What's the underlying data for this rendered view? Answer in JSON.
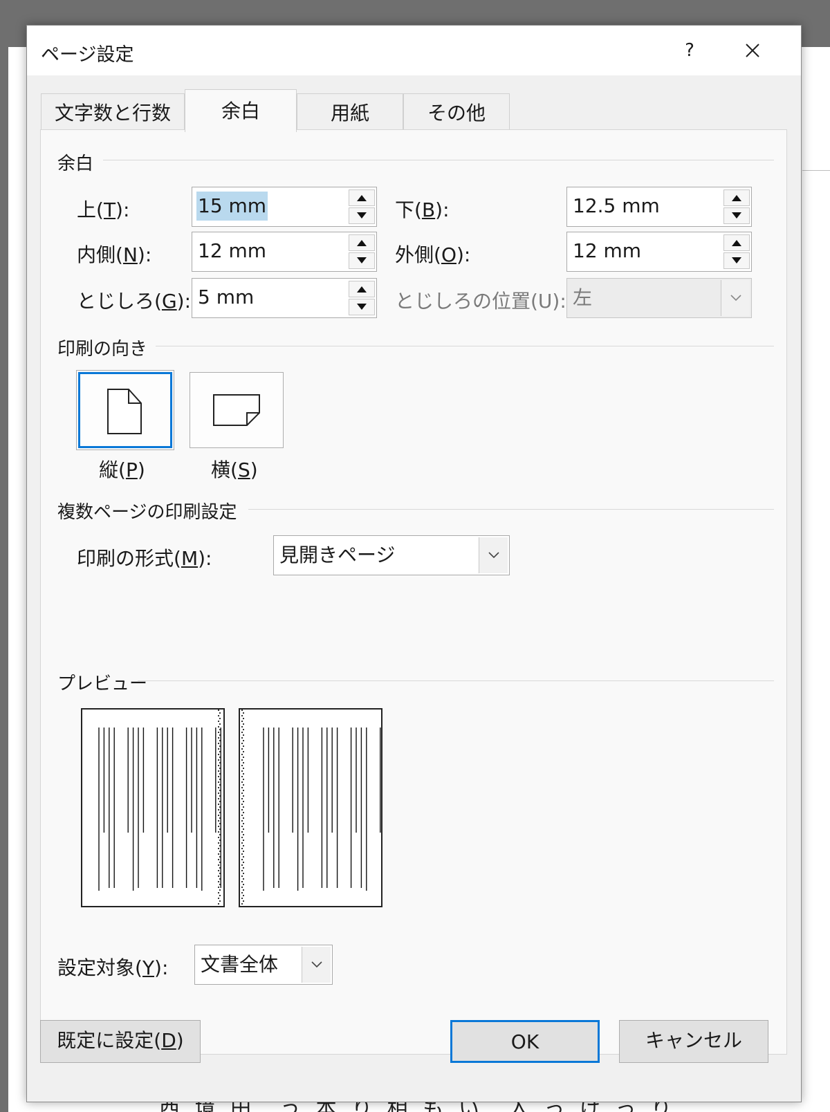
{
  "dialog": {
    "title": "ページ設定",
    "help_label": "?",
    "tabs": [
      {
        "label": "文字数と行数"
      },
      {
        "label": "余白"
      },
      {
        "label": "用紙"
      },
      {
        "label": "その他"
      }
    ],
    "active_tab": "余白"
  },
  "margins": {
    "group_label": "余白",
    "top": {
      "label": "上(",
      "key": "T",
      "suffix": "):",
      "value": "15 mm"
    },
    "bottom": {
      "label": "下(",
      "key": "B",
      "suffix": "):",
      "value": "12.5 mm"
    },
    "inside": {
      "label": "内側(",
      "key": "N",
      "suffix": "):",
      "value": "12 mm"
    },
    "outside": {
      "label": "外側(",
      "key": "O",
      "suffix": "):",
      "value": "12 mm"
    },
    "gutter": {
      "label": "とじしろ(",
      "key": "G",
      "suffix": "):",
      "value": "5 mm"
    },
    "gutter_position": {
      "label": "とじしろの位置(U):",
      "value": "左"
    }
  },
  "orientation": {
    "group_label": "印刷の向き",
    "portrait": {
      "label": "縦(",
      "key": "P",
      "suffix": ")"
    },
    "landscape": {
      "label": "横(",
      "key": "S",
      "suffix": ")"
    },
    "selected": "portrait"
  },
  "multi_page": {
    "group_label": "複数ページの印刷設定",
    "format": {
      "label": "印刷の形式(",
      "key": "M",
      "suffix": "):",
      "value": "見開きページ"
    }
  },
  "preview": {
    "group_label": "プレビュー"
  },
  "apply_to": {
    "label": "設定対象(",
    "key": "Y",
    "suffix": "):",
    "value": "文書全体"
  },
  "buttons": {
    "set_default": {
      "label": "既定に設定(",
      "key": "D",
      "suffix": ")"
    },
    "ok": "OK",
    "cancel": "キャンセル"
  },
  "background": {
    "doc_text": "西 境 田　う 本 り 相 も い　入 っ け っ り"
  },
  "colors": {
    "accent": "#0a78d7",
    "selection": "#b9d9ee"
  }
}
